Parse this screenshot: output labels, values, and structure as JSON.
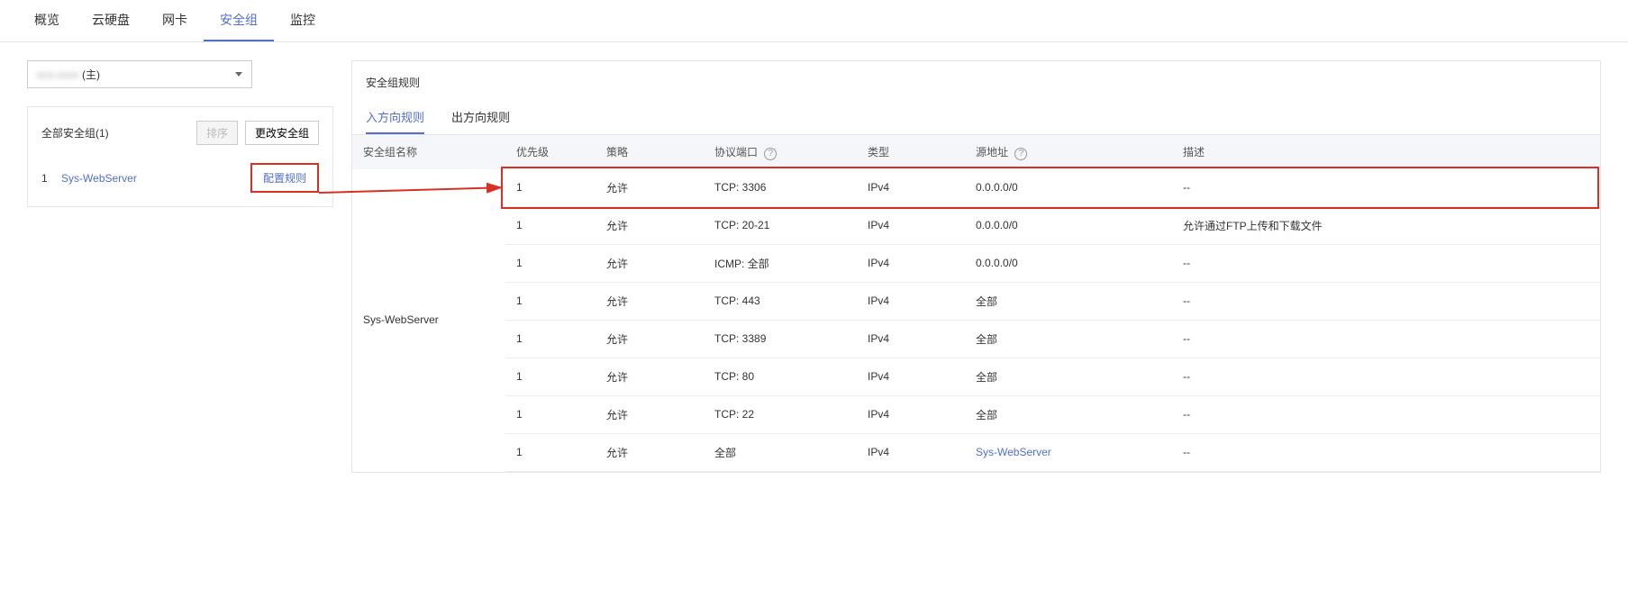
{
  "tabs": [
    "概览",
    "云硬盘",
    "网卡",
    "安全组",
    "监控"
  ],
  "activeTab": 3,
  "dropdown": {
    "blurText": "ecs-xxxx",
    "suffix": "(主)"
  },
  "sidebar": {
    "title": "全部安全组(1)",
    "sortBtn": "排序",
    "changeBtn": "更改安全组",
    "idx": "1",
    "sgName": "Sys-WebServer",
    "configBtn": "配置规则"
  },
  "main": {
    "title": "安全组规则",
    "ruleTabs": [
      "入方向规则",
      "出方向规则"
    ],
    "activeRuleTab": 0,
    "headers": {
      "sgName": "安全组名称",
      "priority": "优先级",
      "policy": "策略",
      "port": "协议端口",
      "type": "类型",
      "source": "源地址",
      "desc": "描述"
    },
    "groupName": "Sys-WebServer",
    "rules": [
      {
        "priority": "1",
        "policy": "允许",
        "port": "TCP: 3306",
        "type": "IPv4",
        "source": "0.0.0.0/0",
        "srcLink": false,
        "desc": "--",
        "highlight": true
      },
      {
        "priority": "1",
        "policy": "允许",
        "port": "TCP: 20-21",
        "type": "IPv4",
        "source": "0.0.0.0/0",
        "srcLink": false,
        "desc": "允许通过FTP上传和下载文件",
        "highlight": false
      },
      {
        "priority": "1",
        "policy": "允许",
        "port": "ICMP: 全部",
        "type": "IPv4",
        "source": "0.0.0.0/0",
        "srcLink": false,
        "desc": "--",
        "highlight": false
      },
      {
        "priority": "1",
        "policy": "允许",
        "port": "TCP: 443",
        "type": "IPv4",
        "source": "全部",
        "srcLink": false,
        "desc": "--",
        "highlight": false
      },
      {
        "priority": "1",
        "policy": "允许",
        "port": "TCP: 3389",
        "type": "IPv4",
        "source": "全部",
        "srcLink": false,
        "desc": "--",
        "highlight": false
      },
      {
        "priority": "1",
        "policy": "允许",
        "port": "TCP: 80",
        "type": "IPv4",
        "source": "全部",
        "srcLink": false,
        "desc": "--",
        "highlight": false
      },
      {
        "priority": "1",
        "policy": "允许",
        "port": "TCP: 22",
        "type": "IPv4",
        "source": "全部",
        "srcLink": false,
        "desc": "--",
        "highlight": false
      },
      {
        "priority": "1",
        "policy": "允许",
        "port": "全部",
        "type": "IPv4",
        "source": "Sys-WebServer",
        "srcLink": true,
        "desc": "--",
        "highlight": false
      }
    ]
  }
}
